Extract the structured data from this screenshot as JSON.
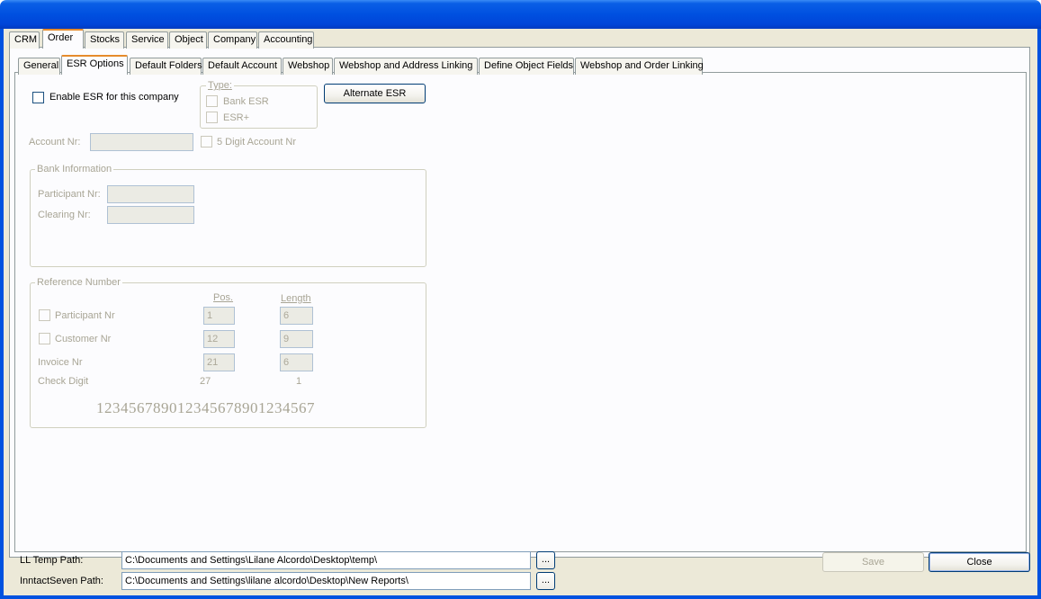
{
  "main_tabs": [
    "CRM",
    "Order",
    "Stocks",
    "Service",
    "Object",
    "Company",
    "Accounting"
  ],
  "sub_tabs": [
    "General",
    "ESR Options",
    "Default Folders",
    "Default Account",
    "Webshop",
    "Webshop and Address Linking",
    "Define Object Fields",
    "Webshop and Order Linking"
  ],
  "esr": {
    "enable_label": "Enable ESR for this company",
    "type_legend": "Type:",
    "bank_esr": "Bank ESR",
    "esr_plus": "ESR+",
    "alternate_button": "Alternate ESR",
    "account_nr_label": "Account Nr:",
    "account_nr_value": "",
    "five_digit_label": "5 Digit Account Nr"
  },
  "bank_info": {
    "legend": "Bank Information",
    "participant_label": "Participant Nr:",
    "participant_value": "",
    "clearing_label": "Clearing Nr:",
    "clearing_value": ""
  },
  "reference": {
    "legend": "Reference Number",
    "col_pos": "Pos.",
    "col_length": "Length",
    "rows": [
      {
        "label": "Participant Nr",
        "pos": "1",
        "length": "6"
      },
      {
        "label": "Customer Nr",
        "pos": "12",
        "length": "9"
      },
      {
        "label": "Invoice Nr",
        "pos": "21",
        "length": "6"
      },
      {
        "label": "Check Digit",
        "pos": "27",
        "length": "1"
      }
    ],
    "digits": "123456789012345678901234567"
  },
  "footer": {
    "ll_temp_label": "LL Temp Path:",
    "ll_temp_value": "C:\\Documents and Settings\\Lilane Alcordo\\Desktop\\temp\\",
    "inntact_label": "InntactSeven Path:",
    "inntact_value": "C:\\Documents and Settings\\lilane alcordo\\Desktop\\New Reports\\",
    "browse_label": "...",
    "save_label": "Save",
    "close_label": "Close"
  }
}
